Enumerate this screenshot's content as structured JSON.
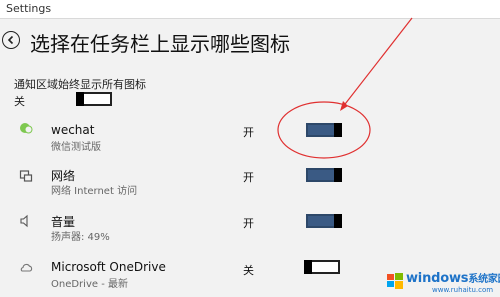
{
  "window": {
    "title": "Settings"
  },
  "header": {
    "title": "选择在任务栏上显示哪些图标"
  },
  "master": {
    "label": "通知区域始终显示所有图标",
    "state": "关",
    "on": false
  },
  "apps": [
    {
      "icon": "wechat-icon",
      "name": "wechat",
      "desc": "微信测试版",
      "state": "开",
      "on": true
    },
    {
      "icon": "network-icon",
      "name": "网络",
      "desc": "网络 Internet 访问",
      "state": "开",
      "on": true
    },
    {
      "icon": "volume-icon",
      "name": "音量",
      "desc": "扬声器: 49%",
      "state": "开",
      "on": true
    },
    {
      "icon": "onedrive-icon",
      "name": "Microsoft OneDrive",
      "desc": "OneDrive - 最新",
      "state": "关",
      "on": false
    }
  ],
  "annotation": {
    "color": "#e03030"
  },
  "watermark": {
    "brand": "windows",
    "cn": "系统家园",
    "url": "www.ruhaitu.com"
  }
}
